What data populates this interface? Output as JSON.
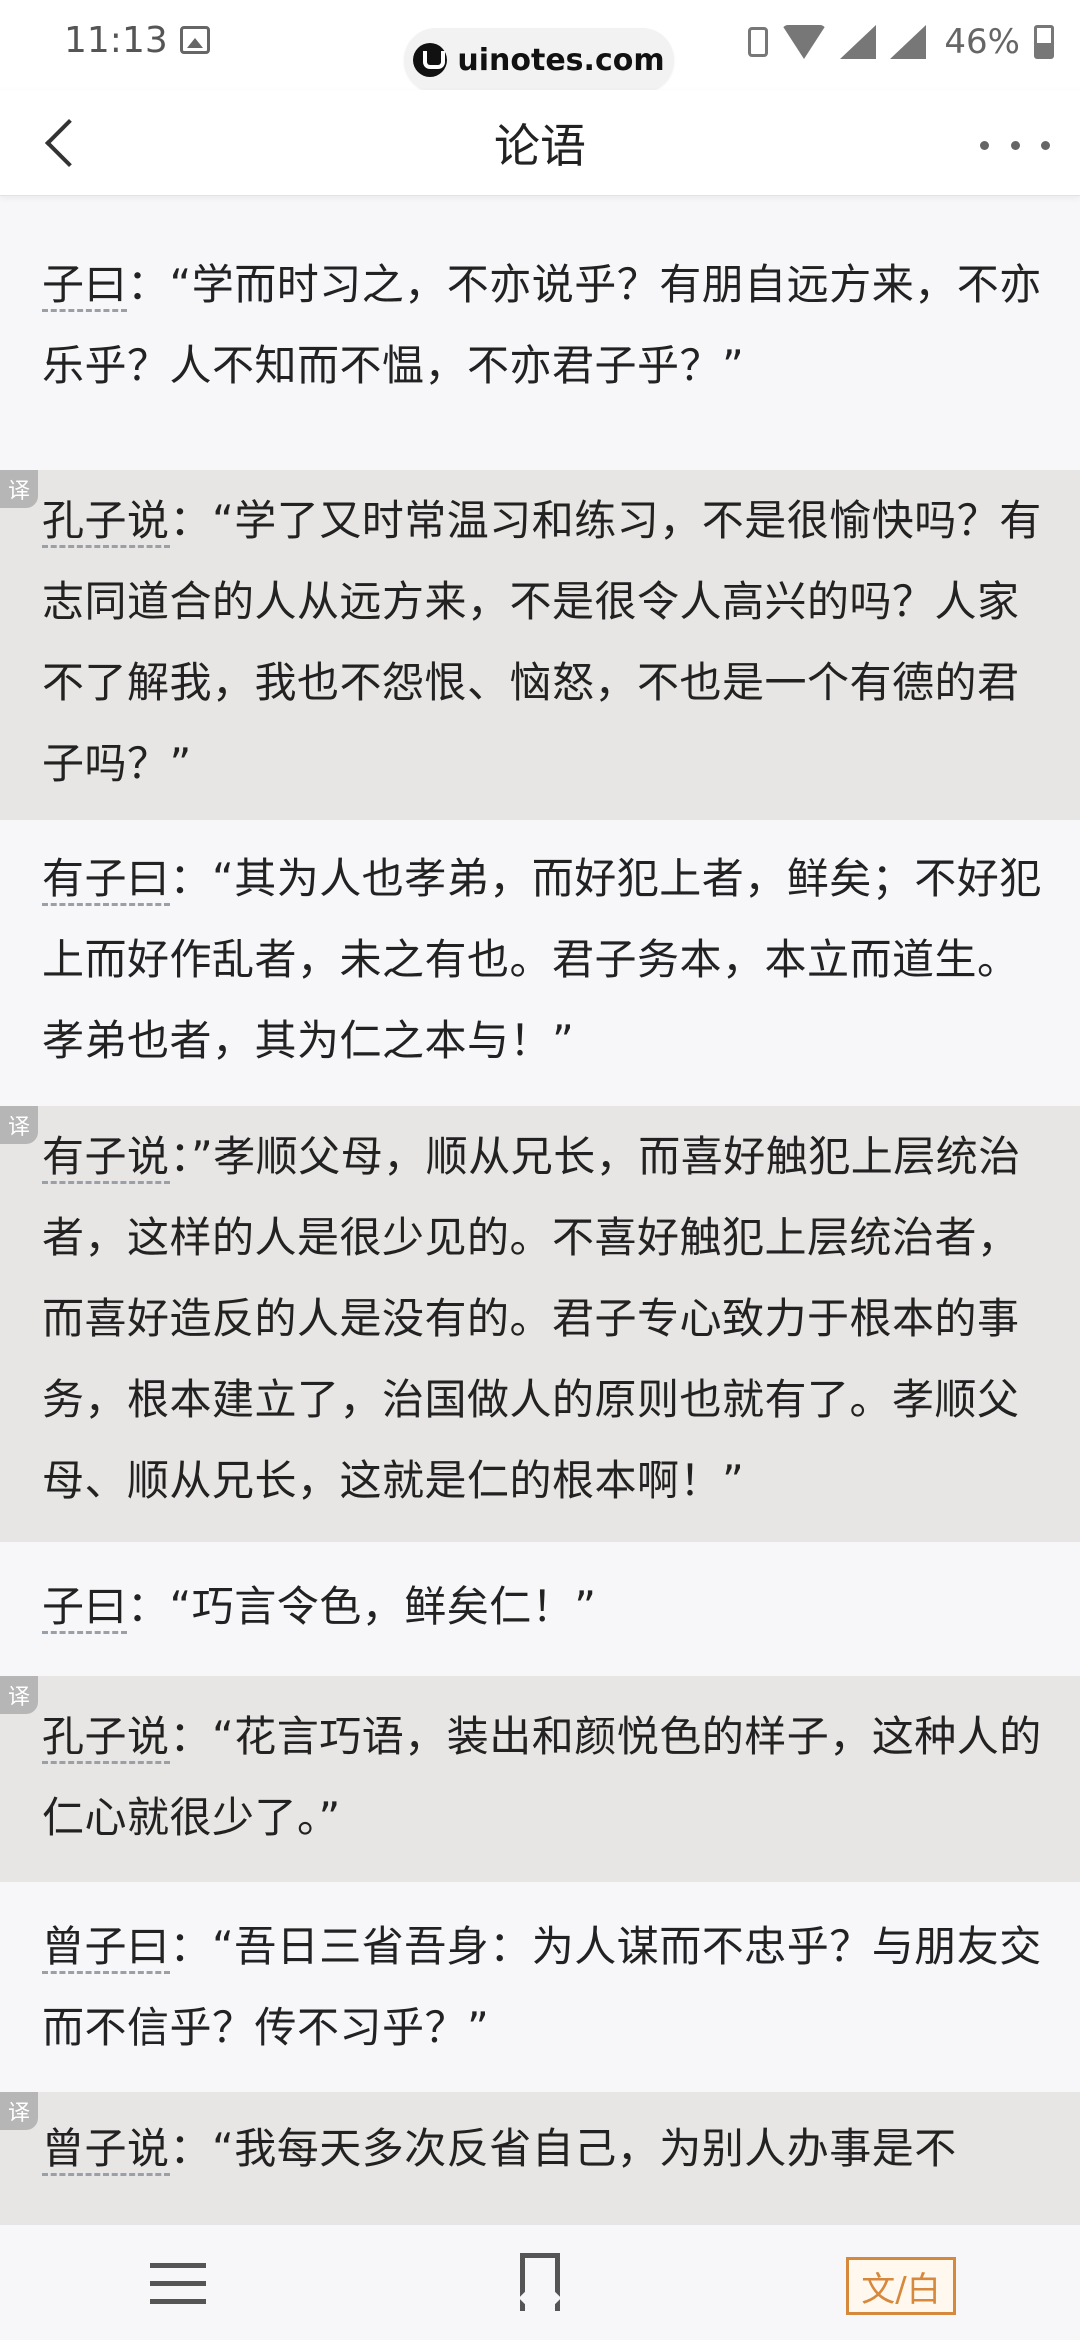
{
  "status_bar": {
    "time": "11:13",
    "url": "uinotes.com",
    "battery": "46%"
  },
  "nav": {
    "title": "论语"
  },
  "content": {
    "blocks": [
      {
        "type": "original",
        "speaker": "子曰",
        "text": "：“学而时习之，不亦说乎？有朋自远方来，不亦乐乎？人不知而不愠，不亦君子乎？”"
      },
      {
        "type": "translation",
        "badge": "译",
        "speaker": "孔子说",
        "text": "：“学了又时常温习和练习，不是很愉快吗？有志同道合的人从远方来，不是很令人高兴的吗？人家不了解我，我也不怨恨、恼怒，不也是一个有德的君子吗？”"
      },
      {
        "type": "original",
        "speaker": "有子曰",
        "text": "：“其为人也孝弟，而好犯上者，鲜矣；不好犯上而好作乱者，未之有也。君子务本，本立而道生。孝弟也者，其为仁之本与！”"
      },
      {
        "type": "translation",
        "badge": "译",
        "speaker": "有子说",
        "text": "：”孝顺父母，顺从兄长，而喜好触犯上层统治者，这样的人是很少见的。不喜好触犯上层统治者，而喜好造反的人是没有的。君子专心致力于根本的事务，根本建立了，治国做人的原则也就有了。孝顺父母、顺从兄长，这就是仁的根本啊！”"
      },
      {
        "type": "original",
        "speaker": "子曰",
        "text": "：“巧言令色，鲜矣仁！”"
      },
      {
        "type": "translation",
        "badge": "译",
        "speaker": "孔子说",
        "text": "：“花言巧语，装出和颜悦色的样子，这种人的仁心就很少了。”"
      },
      {
        "type": "original",
        "speaker": "曾子曰",
        "text": "：“吾日三省吾身：为人谋而不忠乎？与朋友交而不信乎？传不习乎？”"
      },
      {
        "type": "translation",
        "badge": "译",
        "speaker": "曾子说",
        "text": "：“我每天多次反省自己，为别人办事是不"
      }
    ]
  },
  "toolbar": {
    "toggle_label": "文/白"
  }
}
